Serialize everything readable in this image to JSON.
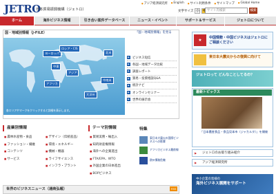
{
  "header": {
    "logo": "JETRO",
    "org_name": "日本貿易振興機構（ジェトロ）",
    "top_links": [
      "アジア経済研究所",
      "English",
      "サイト利用条件",
      "サイトマップ",
      "Global Home"
    ],
    "font_size_label": "文字サイズ",
    "font_sizes": [
      "小",
      "中",
      "大"
    ],
    "search_placeholder": "サイト内検索",
    "search_button": "検索"
  },
  "nav": [
    "ホーム",
    "海外ビジネス情報",
    "引き合い案件データベース",
    "ニュース・イベント",
    "サポート＆サービス",
    "ジェトロについて"
  ],
  "map_panel": {
    "title": "国・地域別情報（J-FILE）",
    "link": "「国・地域別情報」を見る",
    "regions": [
      "ヨーロッパ",
      "ロシア・CIS",
      "中東",
      "アジア",
      "アフリカ",
      "北米",
      "中南米",
      "大洋州"
    ],
    "note": "各エリアやマークをクリックすると詳細を表示します。",
    "menu": [
      "ビジネス短信",
      "各国・地域データ比較",
      "調査レポート",
      "貿易・投資相談Q&A",
      "統計ナビ",
      "オンラインセミナー",
      "世界の展示会"
    ]
  },
  "industry": {
    "title": "産業別情報",
    "col1": [
      "農林水産物・食品",
      "ファッション・繊維",
      "コンテンツ",
      "サービス"
    ],
    "col2": [
      "デザイン（伝統産品）",
      "環境・エネルギー",
      "機械・機器",
      "ライフサイエンス",
      "インフラ・プラント"
    ]
  },
  "theme": {
    "title": "テーマ別情報",
    "items": [
      "貿易実務・輸出入",
      "知的財産権情報",
      "海外への企業進出",
      "FTA/EPA、WTO",
      "外国企業の日本進出",
      "BOPビジネス"
    ]
  },
  "tokusyu": {
    "title": "特集",
    "items": [
      "東日本大震災の国際ビジネスへの影響",
      "アフリカビジネス最前線",
      "欧州債務危機"
    ]
  },
  "news": {
    "title": "世界のビジネスニュース（通商弘報）",
    "rss": "RSS"
  },
  "right": {
    "banner1": "中国情勢・中国ビジネスはジェトロにご相談ください",
    "banner2": "東日本大震災からの復興に向けて",
    "promo_title": "ジェトロって どんなことしてるの？",
    "topics_title": "最新トピックス",
    "topics_caption": "「日本農産食品・食品見本市（ジャカルタ）」を開催",
    "link1": "ジェトロのお取り組み紹介",
    "link2": "アジア経済研究所",
    "bottom_banner1": "中小企業の皆様の",
    "bottom_banner2": "海外ビジネス展開をサポート"
  },
  "colors": {
    "brand_red": "#c8282c",
    "brand_blue": "#1a3f8a",
    "accent_orange": "#f08c00"
  }
}
